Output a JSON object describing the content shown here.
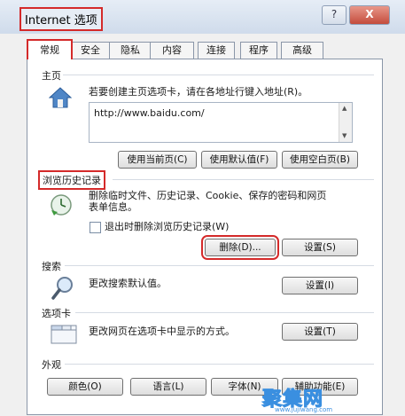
{
  "window": {
    "title": "Internet 选项",
    "help_label": "?",
    "close_label": "X"
  },
  "tabs": [
    {
      "label": "常规",
      "active": true
    },
    {
      "label": "安全"
    },
    {
      "label": "隐私"
    },
    {
      "label": "内容"
    },
    {
      "label": "连接"
    },
    {
      "label": "程序"
    },
    {
      "label": "高级"
    }
  ],
  "home": {
    "title": "主页",
    "description": "若要创建主页选项卡，请在各地址行键入地址(R)。",
    "url": "http://www.baidu.com/",
    "btn_current": "使用当前页(C)",
    "btn_default": "使用默认值(F)",
    "btn_blank": "使用空白页(B)"
  },
  "history": {
    "title": "浏览历史记录",
    "description_1": "删除临时文件、历史记录、Cookie、保存的密码和网页",
    "description_2": "表单信息。",
    "checkbox_label": "退出时删除浏览历史记录(W)",
    "checkbox_checked": false,
    "btn_delete": "删除(D)...",
    "btn_settings": "设置(S)"
  },
  "search": {
    "title": "搜索",
    "description": "更改搜索默认值。",
    "btn_settings": "设置(I)"
  },
  "tabs_group": {
    "title": "选项卡",
    "description": "更改网页在选项卡中显示的方式。",
    "btn_settings": "设置(T)"
  },
  "appearance": {
    "title": "外观",
    "btn_colors": "颜色(O)",
    "btn_languages": "语言(L)",
    "btn_fonts": "字体(N)",
    "btn_accessibility": "辅助功能(E)"
  },
  "watermark": {
    "text": "聚集网",
    "subtext": "www.jujiwang.com"
  }
}
